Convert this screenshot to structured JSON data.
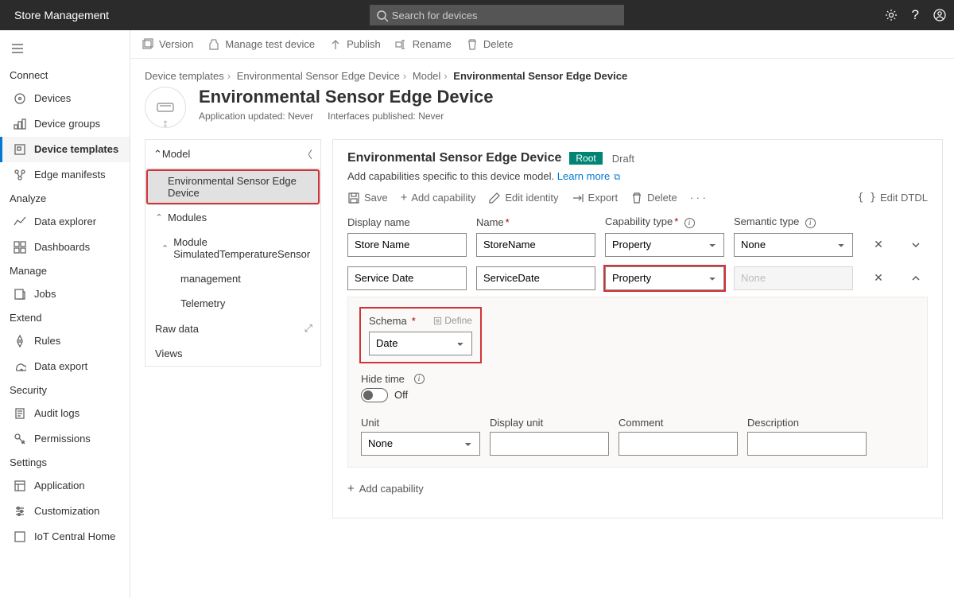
{
  "app_title": "Store Management",
  "search": {
    "placeholder": "Search for devices"
  },
  "sidebar": {
    "groups": [
      {
        "label": "Connect",
        "items": [
          {
            "label": "Devices",
            "slug": "devices"
          },
          {
            "label": "Device groups",
            "slug": "device-groups"
          },
          {
            "label": "Device templates",
            "slug": "device-templates",
            "active": true
          },
          {
            "label": "Edge manifests",
            "slug": "edge-manifests"
          }
        ]
      },
      {
        "label": "Analyze",
        "items": [
          {
            "label": "Data explorer",
            "slug": "data-explorer"
          },
          {
            "label": "Dashboards",
            "slug": "dashboards"
          }
        ]
      },
      {
        "label": "Manage",
        "items": [
          {
            "label": "Jobs",
            "slug": "jobs"
          }
        ]
      },
      {
        "label": "Extend",
        "items": [
          {
            "label": "Rules",
            "slug": "rules"
          },
          {
            "label": "Data export",
            "slug": "data-export"
          }
        ]
      },
      {
        "label": "Security",
        "items": [
          {
            "label": "Audit logs",
            "slug": "audit-logs"
          },
          {
            "label": "Permissions",
            "slug": "permissions"
          }
        ]
      },
      {
        "label": "Settings",
        "items": [
          {
            "label": "Application",
            "slug": "application"
          },
          {
            "label": "Customization",
            "slug": "customization"
          },
          {
            "label": "IoT Central Home",
            "slug": "iot-central-home"
          }
        ]
      }
    ]
  },
  "commandbar": {
    "version": "Version",
    "manage_test_device": "Manage test device",
    "publish": "Publish",
    "rename": "Rename",
    "delete": "Delete"
  },
  "breadcrumb": {
    "items": [
      "Device templates",
      "Environmental Sensor Edge Device",
      "Model",
      "Environmental Sensor Edge Device"
    ]
  },
  "header": {
    "title": "Environmental Sensor Edge Device",
    "app_updated_label": "Application updated:",
    "app_updated_value": "Never",
    "interfaces_pub_label": "Interfaces published:",
    "interfaces_pub_value": "Never"
  },
  "tree": {
    "root": "Model",
    "selected": "Environmental Sensor Edge Device",
    "modules_label": "Modules",
    "module_name": "Module SimulatedTemperatureSensor",
    "module_children": [
      "management",
      "Telemetry"
    ],
    "raw_data": "Raw data",
    "views": "Views"
  },
  "form": {
    "title": "Environmental Sensor Edge Device",
    "root_badge": "Root",
    "draft_badge": "Draft",
    "description": "Add capabilities specific to this device model.",
    "learn_more": "Learn more",
    "cmds": {
      "save": "Save",
      "add_capability": "Add capability",
      "edit_identity": "Edit identity",
      "export": "Export",
      "delete": "Delete",
      "edit_dtdl": "Edit DTDL"
    },
    "columns": {
      "display_name": "Display name",
      "name": "Name",
      "capability_type": "Capability type",
      "semantic_type": "Semantic type"
    },
    "rows": [
      {
        "display_name": "Store Name",
        "name": "StoreName",
        "capability_type": "Property",
        "semantic_type": "None",
        "expanded": false
      },
      {
        "display_name": "Service Date",
        "name": "ServiceDate",
        "capability_type": "Property",
        "semantic_type": "None",
        "expanded": true,
        "semantic_disabled": true
      }
    ],
    "detail": {
      "schema_label": "Schema",
      "define_label": "Define",
      "schema_value": "Date",
      "hide_time_label": "Hide time",
      "hide_time_value": "Off",
      "unit_label": "Unit",
      "unit_value": "None",
      "display_unit_label": "Display unit",
      "display_unit_value": "",
      "comment_label": "Comment",
      "comment_value": "",
      "description_label": "Description",
      "description_value": ""
    },
    "add_capability_footer": "Add capability"
  }
}
